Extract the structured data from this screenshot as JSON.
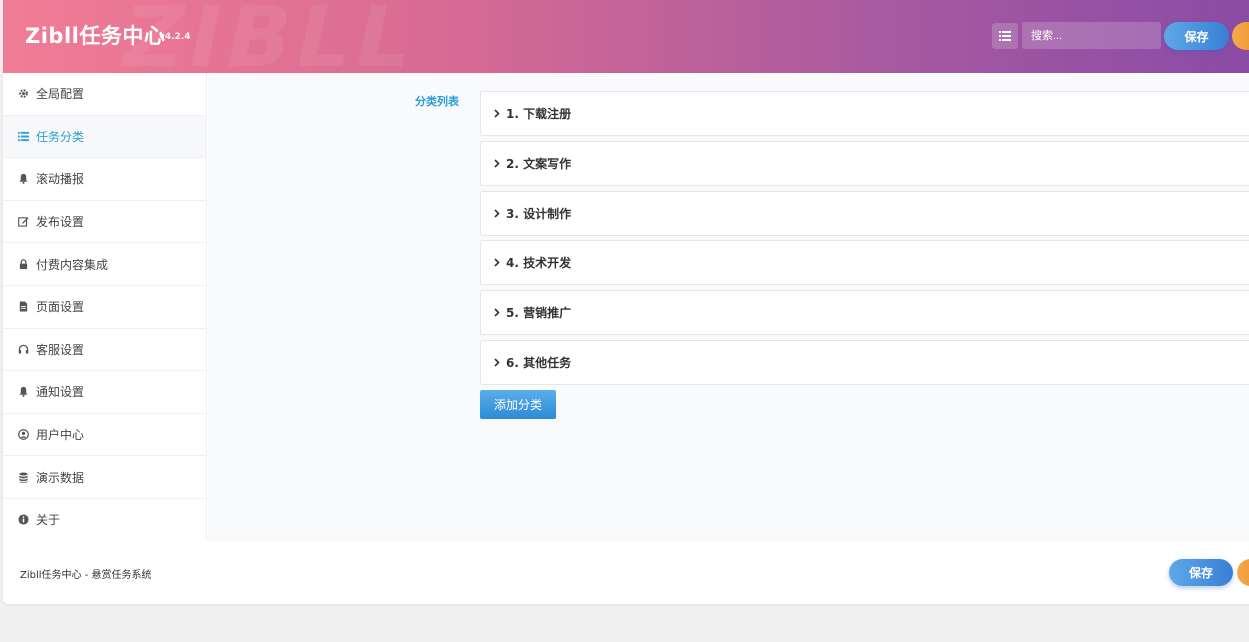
{
  "header": {
    "title": "Zibll任务中心",
    "version": "v4.2.4",
    "watermark": "ZIBLL",
    "search_placeholder": "搜索...",
    "save_label": "保存"
  },
  "sidebar": {
    "items": [
      {
        "label": "全局配置",
        "icon": "gear-icon"
      },
      {
        "label": "任务分类",
        "icon": "list-icon"
      },
      {
        "label": "滚动播报",
        "icon": "bell-icon"
      },
      {
        "label": "发布设置",
        "icon": "edit-icon"
      },
      {
        "label": "付费内容集成",
        "icon": "lock-icon"
      },
      {
        "label": "页面设置",
        "icon": "file-icon"
      },
      {
        "label": "客服设置",
        "icon": "headset-icon"
      },
      {
        "label": "通知设置",
        "icon": "bell-icon"
      },
      {
        "label": "用户中心",
        "icon": "user-circle-icon"
      },
      {
        "label": "演示数据",
        "icon": "database-icon"
      },
      {
        "label": "关于",
        "icon": "info-icon"
      }
    ],
    "active_index": 1
  },
  "main": {
    "section_label": "分类列表",
    "categories": [
      {
        "label": "1. 下载注册"
      },
      {
        "label": "2. 文案写作"
      },
      {
        "label": "3. 设计制作"
      },
      {
        "label": "4. 技术开发"
      },
      {
        "label": "5. 营销推广"
      },
      {
        "label": "6. 其他任务"
      }
    ],
    "add_label": "添加分类"
  },
  "footer": {
    "text": "Zibll任务中心 - 悬赏任务系统",
    "save_label": "保存"
  },
  "colors": {
    "accent": "#2a9fd6",
    "header_start": "#f17c95",
    "header_end": "#8a4ba6",
    "save_button": "#3a7fd5",
    "reset_button": "#ee8c2a"
  }
}
